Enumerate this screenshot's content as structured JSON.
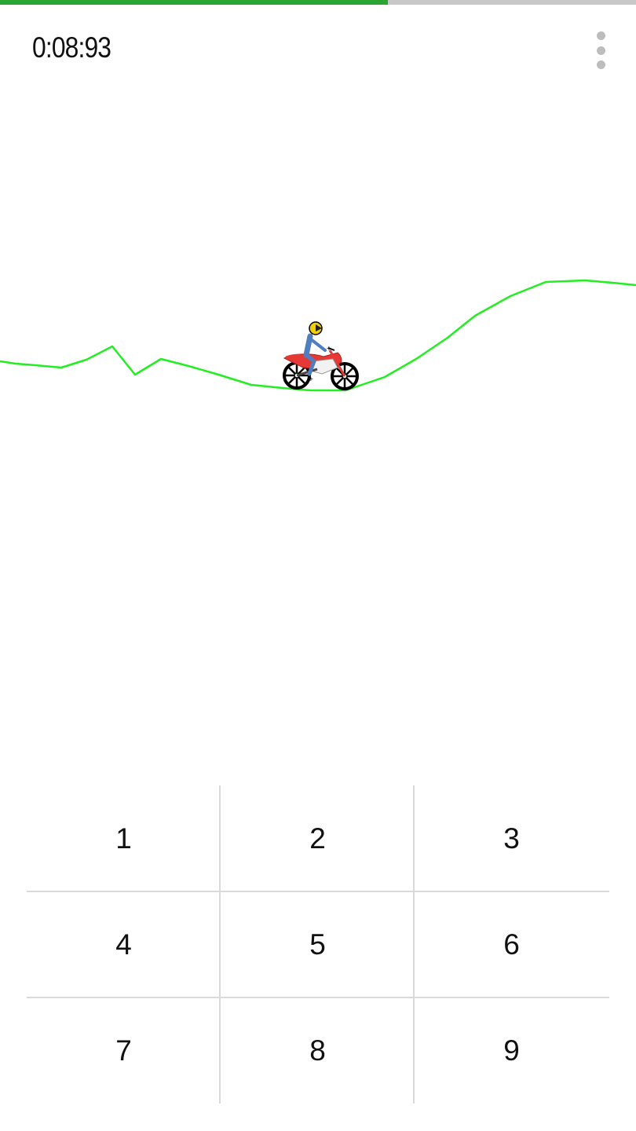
{
  "status": {
    "progress_fraction": 0.61,
    "colors": {
      "fill": "#2aa52f",
      "track": "#c8c8c8"
    }
  },
  "header": {
    "timer": "0:08:93",
    "menu_icon": "more-vert-icon"
  },
  "game": {
    "track_color": "#22ee22",
    "rider_icon": "motorbike-rider-icon"
  },
  "keypad": {
    "keys": [
      "1",
      "2",
      "3",
      "4",
      "5",
      "6",
      "7",
      "8",
      "9"
    ]
  }
}
